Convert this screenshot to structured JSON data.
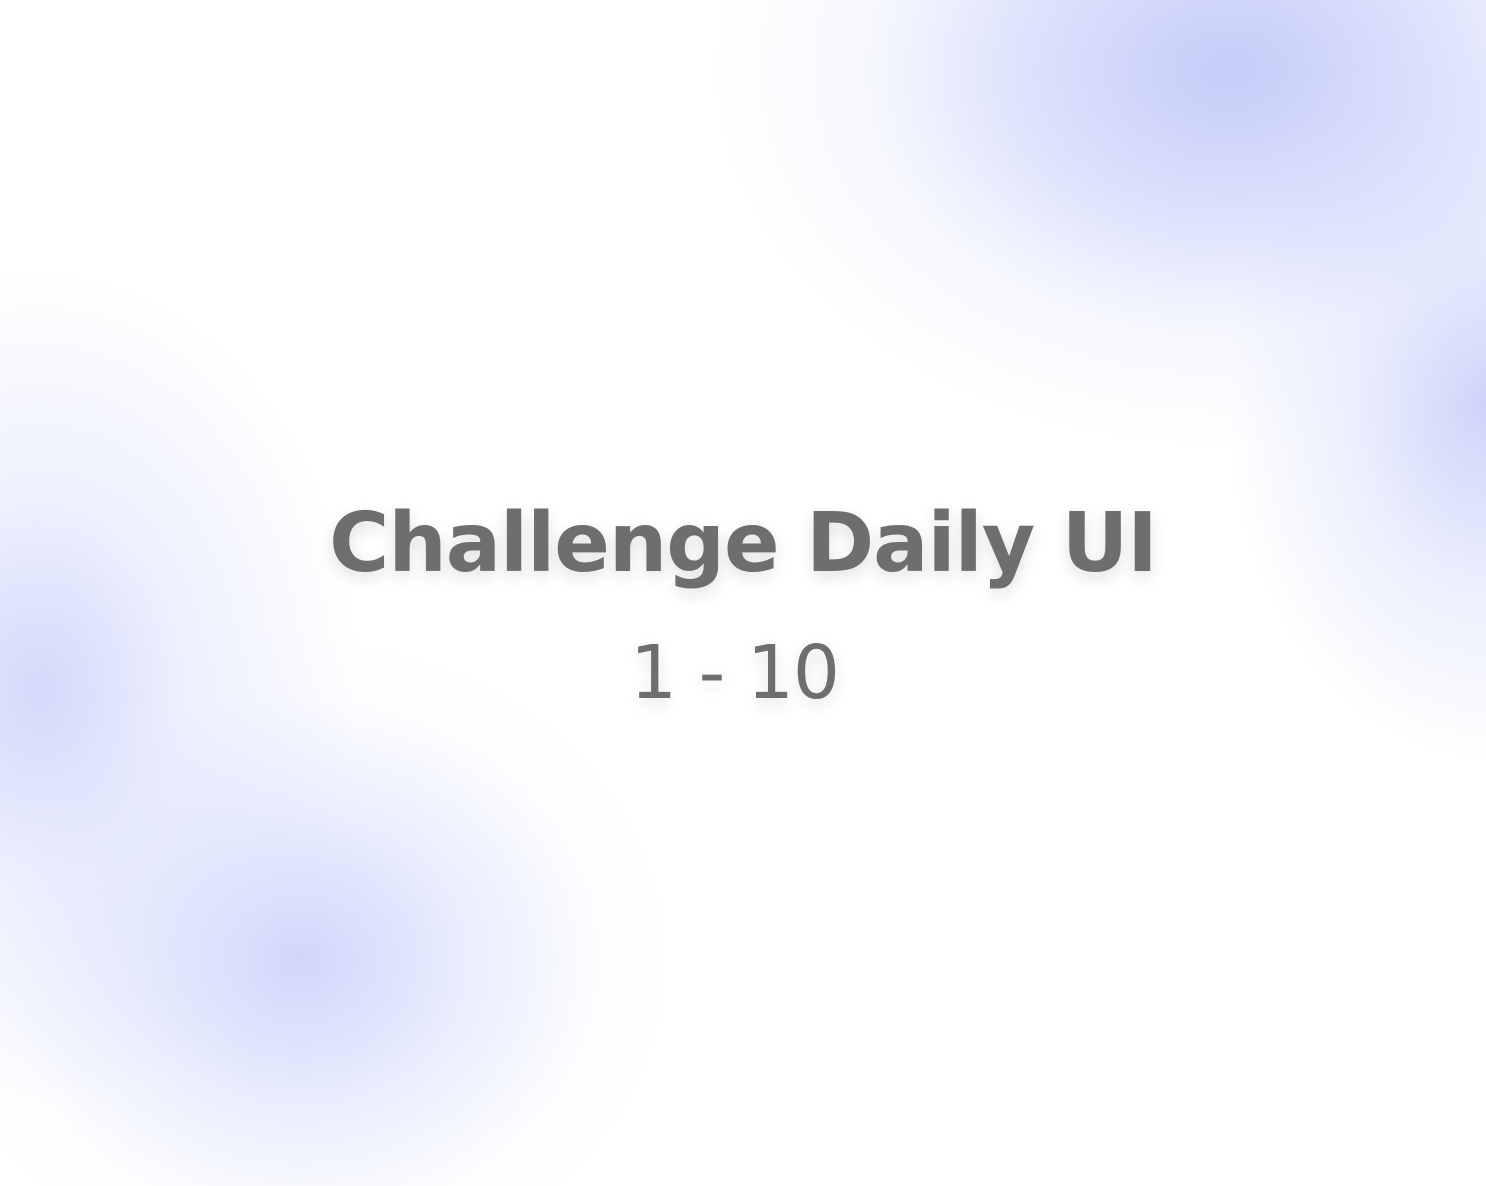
{
  "main": {
    "title": "Challenge Daily UI",
    "range": "1 - 10"
  },
  "colors": {
    "text": "#6e6e6e",
    "background": "#ffffff",
    "accent_blob": "#c1caf8"
  }
}
